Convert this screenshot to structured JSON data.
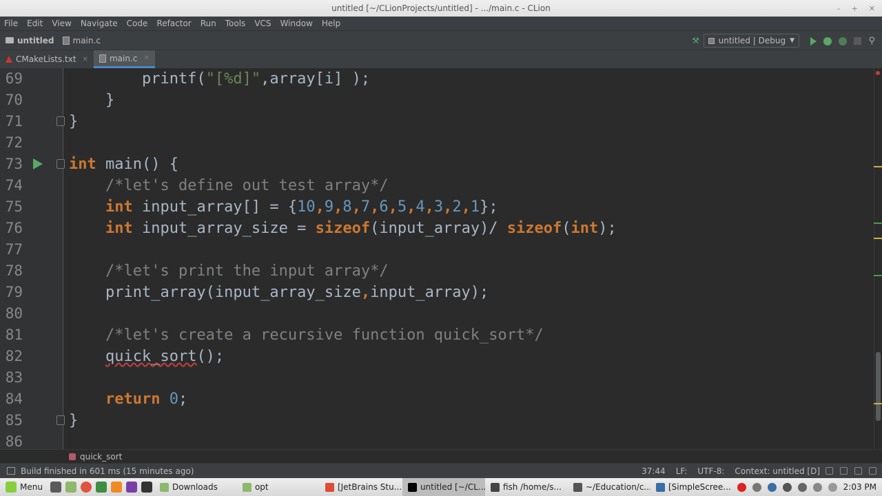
{
  "window": {
    "title": "untitled [~/CLionProjects/untitled] - .../main.c - CLion"
  },
  "menu": [
    "File",
    "Edit",
    "View",
    "Navigate",
    "Code",
    "Refactor",
    "Run",
    "Tools",
    "VCS",
    "Window",
    "Help"
  ],
  "nav": {
    "project": "untitled",
    "file": "main.c",
    "run_config": "untitled | Debug"
  },
  "tabs": [
    {
      "label": "CMakeLists.txt"
    },
    {
      "label": "main.c"
    }
  ],
  "editor": {
    "lines": [
      {
        "n": "69",
        "tokens": [
          {
            "t": "        printf(",
            "c": ""
          },
          {
            "t": "\"[%d]\"",
            "c": "str"
          },
          {
            "t": ",array[i] );",
            "c": ""
          }
        ]
      },
      {
        "n": "70",
        "tokens": [
          {
            "t": "    }",
            "c": ""
          }
        ]
      },
      {
        "n": "71",
        "tokens": [
          {
            "t": "}",
            "c": ""
          }
        ]
      },
      {
        "n": "72",
        "tokens": []
      },
      {
        "n": "73",
        "tokens": [
          {
            "t": "int",
            "c": "kw"
          },
          {
            "t": " main() {",
            "c": ""
          }
        ]
      },
      {
        "n": "74",
        "tokens": [
          {
            "t": "    /*let's define out test array*/",
            "c": "cm"
          }
        ]
      },
      {
        "n": "75",
        "tokens": [
          {
            "t": "    ",
            "c": ""
          },
          {
            "t": "int",
            "c": "kw"
          },
          {
            "t": " input_array[] = {",
            "c": ""
          },
          {
            "t": "10",
            "c": "num"
          },
          {
            "t": ",",
            "c": "kw"
          },
          {
            "t": "9",
            "c": "num"
          },
          {
            "t": ",",
            "c": "kw"
          },
          {
            "t": "8",
            "c": "num"
          },
          {
            "t": ",",
            "c": "kw"
          },
          {
            "t": "7",
            "c": "num"
          },
          {
            "t": ",",
            "c": "kw"
          },
          {
            "t": "6",
            "c": "num"
          },
          {
            "t": ",",
            "c": "kw"
          },
          {
            "t": "5",
            "c": "num"
          },
          {
            "t": ",",
            "c": "kw"
          },
          {
            "t": "4",
            "c": "num"
          },
          {
            "t": ",",
            "c": "kw"
          },
          {
            "t": "3",
            "c": "num"
          },
          {
            "t": ",",
            "c": "kw"
          },
          {
            "t": "2",
            "c": "num"
          },
          {
            "t": ",",
            "c": "kw"
          },
          {
            "t": "1",
            "c": "num"
          },
          {
            "t": "};",
            "c": ""
          }
        ]
      },
      {
        "n": "76",
        "tokens": [
          {
            "t": "    ",
            "c": ""
          },
          {
            "t": "int",
            "c": "kw"
          },
          {
            "t": " input_array_size = ",
            "c": ""
          },
          {
            "t": "sizeof",
            "c": "kw"
          },
          {
            "t": "(input_array)/ ",
            "c": ""
          },
          {
            "t": "sizeof",
            "c": "kw"
          },
          {
            "t": "(",
            "c": ""
          },
          {
            "t": "int",
            "c": "kw"
          },
          {
            "t": ");",
            "c": ""
          }
        ]
      },
      {
        "n": "77",
        "tokens": []
      },
      {
        "n": "78",
        "tokens": [
          {
            "t": "    /*let's print the input array*/",
            "c": "cm"
          }
        ]
      },
      {
        "n": "79",
        "tokens": [
          {
            "t": "    print_array(input_array_size",
            "c": ""
          },
          {
            "t": ",",
            "c": "kw"
          },
          {
            "t": "input_array);",
            "c": ""
          }
        ]
      },
      {
        "n": "80",
        "tokens": []
      },
      {
        "n": "81",
        "tokens": [
          {
            "t": "    /*let's create a recursive function quick_sort*/",
            "c": "cm"
          }
        ]
      },
      {
        "n": "82",
        "tokens": [
          {
            "t": "    ",
            "c": ""
          },
          {
            "t": "quick_sort",
            "c": "err"
          },
          {
            "t": "();",
            "c": ""
          }
        ]
      },
      {
        "n": "83",
        "tokens": []
      },
      {
        "n": "84",
        "tokens": [
          {
            "t": "    ",
            "c": ""
          },
          {
            "t": "return",
            "c": "kw"
          },
          {
            "t": " ",
            "c": ""
          },
          {
            "t": "0",
            "c": "num"
          },
          {
            "t": ";",
            "c": ""
          }
        ]
      },
      {
        "n": "85",
        "tokens": [
          {
            "t": "}",
            "c": ""
          }
        ]
      },
      {
        "n": "86",
        "tokens": []
      }
    ]
  },
  "breadcrumb": {
    "label": "quick_sort"
  },
  "status": {
    "message": "Build finished in 601 ms (15 minutes ago)",
    "position": "37:44",
    "line_sep": "LF:",
    "encoding": "UTF-8:",
    "context": "Context: untitled [D]"
  },
  "taskbar": {
    "menu_label": "Menu",
    "items": [
      {
        "label": "Downloads",
        "color": "#8fb86b"
      },
      {
        "label": "opt",
        "color": "#8fb86b"
      },
      {
        "label": "[JetBrains Stu...",
        "color": "#dd4b39"
      },
      {
        "label": "untitled [~/CL...",
        "color": "#000000"
      },
      {
        "label": "fish  /home/s...",
        "color": "#444444"
      },
      {
        "label": "~/Education/c...",
        "color": "#555555"
      },
      {
        "label": "[SimpleScree...",
        "color": "#3a6ea5"
      }
    ],
    "clock": "2:03 PM"
  }
}
